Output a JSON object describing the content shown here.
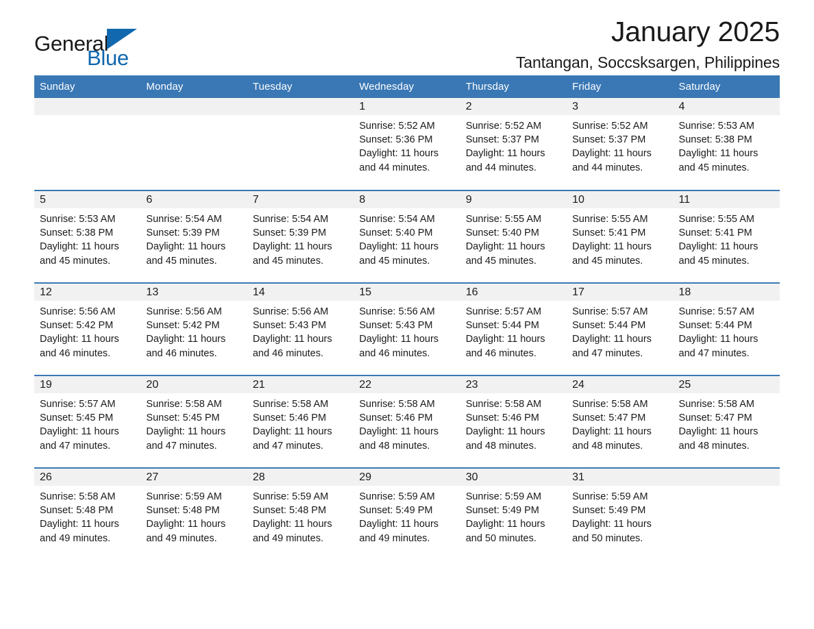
{
  "brand": {
    "name_part1": "General",
    "name_part2": "Blue",
    "logo_icon": "blue-triangle-icon",
    "accent_color": "#1168ae"
  },
  "header": {
    "title": "January 2025",
    "subtitle": "Tantangan, Soccsksargen, Philippines"
  },
  "theme": {
    "header_blue": "#3a78b5",
    "daynum_band": "#f1f1f1",
    "text": "#1a1a1a"
  },
  "calendar": {
    "weekday_headers": [
      "Sunday",
      "Monday",
      "Tuesday",
      "Wednesday",
      "Thursday",
      "Friday",
      "Saturday"
    ],
    "weeks": [
      [
        {
          "day": "",
          "blank": true
        },
        {
          "day": "",
          "blank": true
        },
        {
          "day": "",
          "blank": true
        },
        {
          "day": "1",
          "sunrise": "Sunrise: 5:52 AM",
          "sunset": "Sunset: 5:36 PM",
          "daylight1": "Daylight: 11 hours",
          "daylight2": "and 44 minutes."
        },
        {
          "day": "2",
          "sunrise": "Sunrise: 5:52 AM",
          "sunset": "Sunset: 5:37 PM",
          "daylight1": "Daylight: 11 hours",
          "daylight2": "and 44 minutes."
        },
        {
          "day": "3",
          "sunrise": "Sunrise: 5:52 AM",
          "sunset": "Sunset: 5:37 PM",
          "daylight1": "Daylight: 11 hours",
          "daylight2": "and 44 minutes."
        },
        {
          "day": "4",
          "sunrise": "Sunrise: 5:53 AM",
          "sunset": "Sunset: 5:38 PM",
          "daylight1": "Daylight: 11 hours",
          "daylight2": "and 45 minutes."
        }
      ],
      [
        {
          "day": "5",
          "sunrise": "Sunrise: 5:53 AM",
          "sunset": "Sunset: 5:38 PM",
          "daylight1": "Daylight: 11 hours",
          "daylight2": "and 45 minutes."
        },
        {
          "day": "6",
          "sunrise": "Sunrise: 5:54 AM",
          "sunset": "Sunset: 5:39 PM",
          "daylight1": "Daylight: 11 hours",
          "daylight2": "and 45 minutes."
        },
        {
          "day": "7",
          "sunrise": "Sunrise: 5:54 AM",
          "sunset": "Sunset: 5:39 PM",
          "daylight1": "Daylight: 11 hours",
          "daylight2": "and 45 minutes."
        },
        {
          "day": "8",
          "sunrise": "Sunrise: 5:54 AM",
          "sunset": "Sunset: 5:40 PM",
          "daylight1": "Daylight: 11 hours",
          "daylight2": "and 45 minutes."
        },
        {
          "day": "9",
          "sunrise": "Sunrise: 5:55 AM",
          "sunset": "Sunset: 5:40 PM",
          "daylight1": "Daylight: 11 hours",
          "daylight2": "and 45 minutes."
        },
        {
          "day": "10",
          "sunrise": "Sunrise: 5:55 AM",
          "sunset": "Sunset: 5:41 PM",
          "daylight1": "Daylight: 11 hours",
          "daylight2": "and 45 minutes."
        },
        {
          "day": "11",
          "sunrise": "Sunrise: 5:55 AM",
          "sunset": "Sunset: 5:41 PM",
          "daylight1": "Daylight: 11 hours",
          "daylight2": "and 45 minutes."
        }
      ],
      [
        {
          "day": "12",
          "sunrise": "Sunrise: 5:56 AM",
          "sunset": "Sunset: 5:42 PM",
          "daylight1": "Daylight: 11 hours",
          "daylight2": "and 46 minutes."
        },
        {
          "day": "13",
          "sunrise": "Sunrise: 5:56 AM",
          "sunset": "Sunset: 5:42 PM",
          "daylight1": "Daylight: 11 hours",
          "daylight2": "and 46 minutes."
        },
        {
          "day": "14",
          "sunrise": "Sunrise: 5:56 AM",
          "sunset": "Sunset: 5:43 PM",
          "daylight1": "Daylight: 11 hours",
          "daylight2": "and 46 minutes."
        },
        {
          "day": "15",
          "sunrise": "Sunrise: 5:56 AM",
          "sunset": "Sunset: 5:43 PM",
          "daylight1": "Daylight: 11 hours",
          "daylight2": "and 46 minutes."
        },
        {
          "day": "16",
          "sunrise": "Sunrise: 5:57 AM",
          "sunset": "Sunset: 5:44 PM",
          "daylight1": "Daylight: 11 hours",
          "daylight2": "and 46 minutes."
        },
        {
          "day": "17",
          "sunrise": "Sunrise: 5:57 AM",
          "sunset": "Sunset: 5:44 PM",
          "daylight1": "Daylight: 11 hours",
          "daylight2": "and 47 minutes."
        },
        {
          "day": "18",
          "sunrise": "Sunrise: 5:57 AM",
          "sunset": "Sunset: 5:44 PM",
          "daylight1": "Daylight: 11 hours",
          "daylight2": "and 47 minutes."
        }
      ],
      [
        {
          "day": "19",
          "sunrise": "Sunrise: 5:57 AM",
          "sunset": "Sunset: 5:45 PM",
          "daylight1": "Daylight: 11 hours",
          "daylight2": "and 47 minutes."
        },
        {
          "day": "20",
          "sunrise": "Sunrise: 5:58 AM",
          "sunset": "Sunset: 5:45 PM",
          "daylight1": "Daylight: 11 hours",
          "daylight2": "and 47 minutes."
        },
        {
          "day": "21",
          "sunrise": "Sunrise: 5:58 AM",
          "sunset": "Sunset: 5:46 PM",
          "daylight1": "Daylight: 11 hours",
          "daylight2": "and 47 minutes."
        },
        {
          "day": "22",
          "sunrise": "Sunrise: 5:58 AM",
          "sunset": "Sunset: 5:46 PM",
          "daylight1": "Daylight: 11 hours",
          "daylight2": "and 48 minutes."
        },
        {
          "day": "23",
          "sunrise": "Sunrise: 5:58 AM",
          "sunset": "Sunset: 5:46 PM",
          "daylight1": "Daylight: 11 hours",
          "daylight2": "and 48 minutes."
        },
        {
          "day": "24",
          "sunrise": "Sunrise: 5:58 AM",
          "sunset": "Sunset: 5:47 PM",
          "daylight1": "Daylight: 11 hours",
          "daylight2": "and 48 minutes."
        },
        {
          "day": "25",
          "sunrise": "Sunrise: 5:58 AM",
          "sunset": "Sunset: 5:47 PM",
          "daylight1": "Daylight: 11 hours",
          "daylight2": "and 48 minutes."
        }
      ],
      [
        {
          "day": "26",
          "sunrise": "Sunrise: 5:58 AM",
          "sunset": "Sunset: 5:48 PM",
          "daylight1": "Daylight: 11 hours",
          "daylight2": "and 49 minutes."
        },
        {
          "day": "27",
          "sunrise": "Sunrise: 5:59 AM",
          "sunset": "Sunset: 5:48 PM",
          "daylight1": "Daylight: 11 hours",
          "daylight2": "and 49 minutes."
        },
        {
          "day": "28",
          "sunrise": "Sunrise: 5:59 AM",
          "sunset": "Sunset: 5:48 PM",
          "daylight1": "Daylight: 11 hours",
          "daylight2": "and 49 minutes."
        },
        {
          "day": "29",
          "sunrise": "Sunrise: 5:59 AM",
          "sunset": "Sunset: 5:49 PM",
          "daylight1": "Daylight: 11 hours",
          "daylight2": "and 49 minutes."
        },
        {
          "day": "30",
          "sunrise": "Sunrise: 5:59 AM",
          "sunset": "Sunset: 5:49 PM",
          "daylight1": "Daylight: 11 hours",
          "daylight2": "and 50 minutes."
        },
        {
          "day": "31",
          "sunrise": "Sunrise: 5:59 AM",
          "sunset": "Sunset: 5:49 PM",
          "daylight1": "Daylight: 11 hours",
          "daylight2": "and 50 minutes."
        },
        {
          "day": "",
          "blank": true
        }
      ]
    ]
  }
}
